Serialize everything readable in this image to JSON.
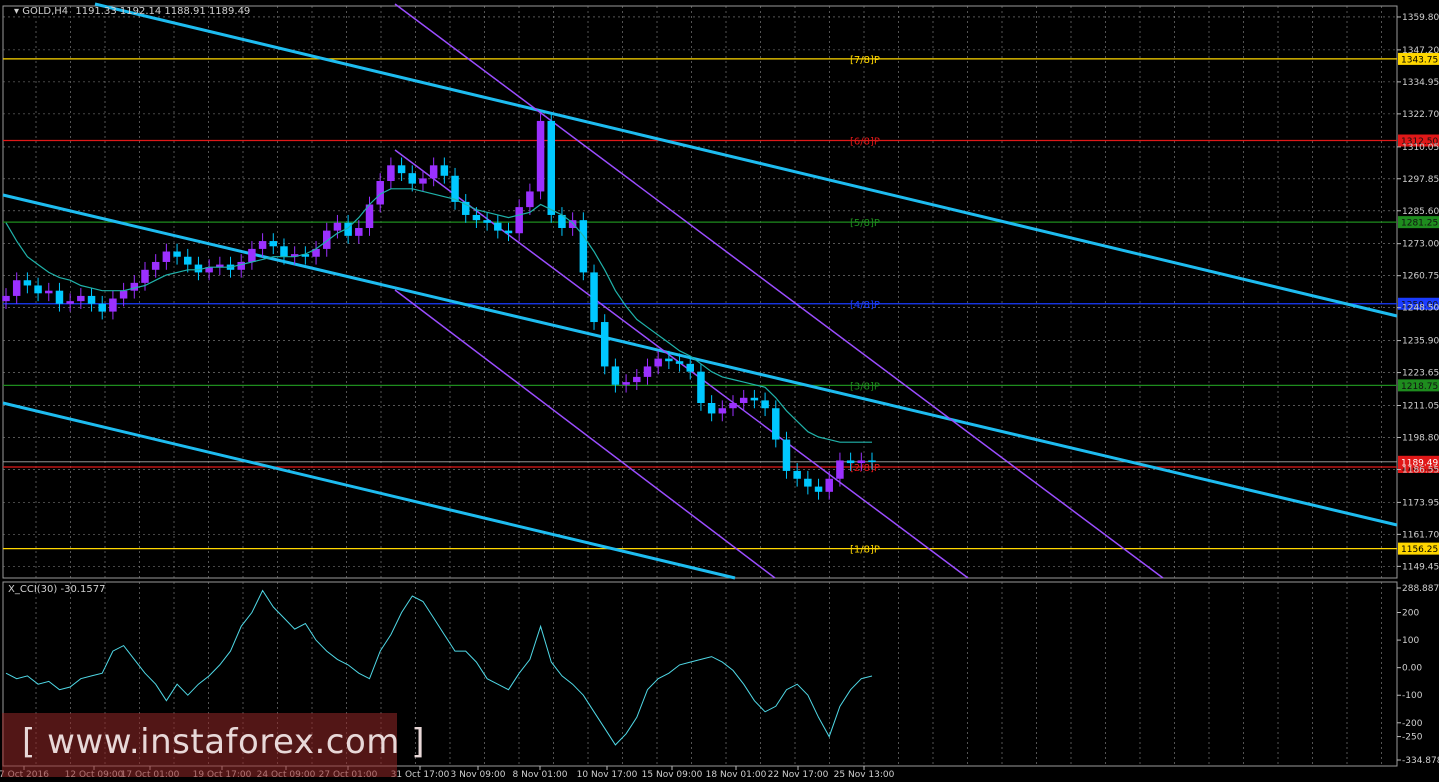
{
  "header": {
    "symbol_label": "GOLD,H4",
    "ohlc_text": "1191.33 1192.14 1188.91 1189.49"
  },
  "indicator": {
    "label": "X_CCI(30) -30.1577",
    "levels": [
      "288.8871",
      "200",
      "100",
      "0.00",
      "-100",
      "-200",
      "-250",
      "-334.8787"
    ]
  },
  "watermark": {
    "text": "[ www.instaforex.com ]"
  },
  "colors": {
    "background": "#000000",
    "grid": "#8a8a8a",
    "bull_candle": "#9b30ff",
    "bear_candle": "#00c8ff",
    "moving_average": "#20b2aa",
    "trend_channel": "#1ebcf0",
    "regression_channel": "#9b4dff",
    "cci_line": "#4fd8e6"
  },
  "chart_data": {
    "type": "candlestick",
    "title": "GOLD,H4",
    "y_ticks": [
      "1359.80",
      "1347.20",
      "1334.95",
      "1322.70",
      "1310.05",
      "1297.85",
      "1285.60",
      "1273.00",
      "1260.75",
      "1248.50",
      "1235.90",
      "1223.65",
      "1211.05",
      "1198.80",
      "1186.55",
      "1173.95",
      "1161.70",
      "1149.45"
    ],
    "ylim": [
      1145,
      1364
    ],
    "x_ticks": [
      "7 Oct 2016",
      "12 Oct 09:00",
      "17 Oct 01:00",
      "19 Oct 17:00",
      "24 Oct 09:00",
      "27 Oct 01:00",
      "31 Oct 17:00",
      "3 Nov 09:00",
      "8 Nov 01:00",
      "10 Nov 17:00",
      "15 Nov 09:00",
      "18 Nov 01:00",
      "22 Nov 17:00",
      "25 Nov 13:00"
    ],
    "murrey_levels": [
      {
        "label": "[7/8]P",
        "price": 1343.75,
        "price_text": "1343.75",
        "color": "#ffd700"
      },
      {
        "label": "[6/8]P",
        "price": 1312.5,
        "price_text": "1312.50",
        "color": "#e01818"
      },
      {
        "label": "[5/8]P",
        "price": 1281.25,
        "price_text": "1281.25",
        "color": "#1e8c1e"
      },
      {
        "label": "[4/8]P",
        "price": 1250.0,
        "price_text": "1250.00",
        "color": "#1a3cff"
      },
      {
        "label": "[3/8]P",
        "price": 1218.75,
        "price_text": "1218.75",
        "color": "#1e8c1e"
      },
      {
        "label": "[2/8]P",
        "price": 1187.5,
        "price_text": "1187.50",
        "color": "#e01818"
      },
      {
        "label": "[1/8]P",
        "price": 1156.25,
        "price_text": "1156.25",
        "color": "#ffd700"
      }
    ],
    "current_price": 1189.49,
    "current_price_text": "1189.49",
    "close_series": [
      1253,
      1259,
      1257,
      1254,
      1255,
      1250,
      1251,
      1253,
      1250,
      1247,
      1252,
      1255,
      1258,
      1263,
      1266,
      1270,
      1268,
      1265,
      1262,
      1264,
      1265,
      1263,
      1266,
      1271,
      1274,
      1272,
      1268,
      1269,
      1268,
      1271,
      1278,
      1281,
      1276,
      1279,
      1288,
      1297,
      1303,
      1300,
      1296,
      1298,
      1303,
      1299,
      1289,
      1284,
      1282,
      1281,
      1278,
      1277,
      1287,
      1293,
      1320,
      1284,
      1279,
      1282,
      1262,
      1243,
      1226,
      1219,
      1220,
      1222,
      1226,
      1229,
      1228,
      1227,
      1224,
      1212,
      1208,
      1210,
      1212,
      1214,
      1213,
      1210,
      1198,
      1186,
      1183,
      1180,
      1178,
      1183,
      1190,
      1189,
      1190,
      1189.5
    ],
    "ma_series": [
      1281,
      1274,
      1268,
      1265,
      1262,
      1260,
      1259,
      1257,
      1256,
      1255,
      1255,
      1255,
      1256,
      1257,
      1259,
      1261,
      1262,
      1263,
      1263,
      1264,
      1264,
      1264,
      1265,
      1266,
      1267,
      1268,
      1268,
      1268,
      1269,
      1271,
      1274,
      1277,
      1279,
      1283,
      1288,
      1292,
      1294,
      1294,
      1294,
      1293,
      1292,
      1291,
      1290,
      1288,
      1286,
      1285,
      1284,
      1283,
      1284,
      1285,
      1288,
      1286,
      1284,
      1281,
      1276,
      1270,
      1263,
      1255,
      1249,
      1244,
      1241,
      1238,
      1235,
      1232,
      1230,
      1227,
      1224,
      1222,
      1221,
      1220,
      1219,
      1218,
      1214,
      1209,
      1205,
      1201,
      1199,
      1198,
      1197,
      1197,
      1197,
      1197
    ],
    "cci_series": [
      -20,
      -40,
      -30,
      -60,
      -50,
      -80,
      -70,
      -40,
      -30,
      -20,
      60,
      80,
      30,
      -20,
      -60,
      -120,
      -60,
      -100,
      -60,
      -30,
      10,
      60,
      150,
      200,
      280,
      220,
      180,
      140,
      160,
      100,
      60,
      30,
      10,
      -20,
      -40,
      60,
      120,
      200,
      260,
      240,
      180,
      120,
      60,
      60,
      20,
      -40,
      -60,
      -80,
      -20,
      30,
      150,
      20,
      -30,
      -60,
      -100,
      -160,
      -220,
      -280,
      -240,
      -180,
      -80,
      -40,
      -20,
      10,
      20,
      30,
      40,
      20,
      -10,
      -60,
      -120,
      -160,
      -140,
      -80,
      -60,
      -100,
      -180,
      -250,
      -140,
      -80,
      -40,
      -30.1577
    ],
    "cci_ylim": [
      -334.8787,
      288.8871
    ]
  }
}
